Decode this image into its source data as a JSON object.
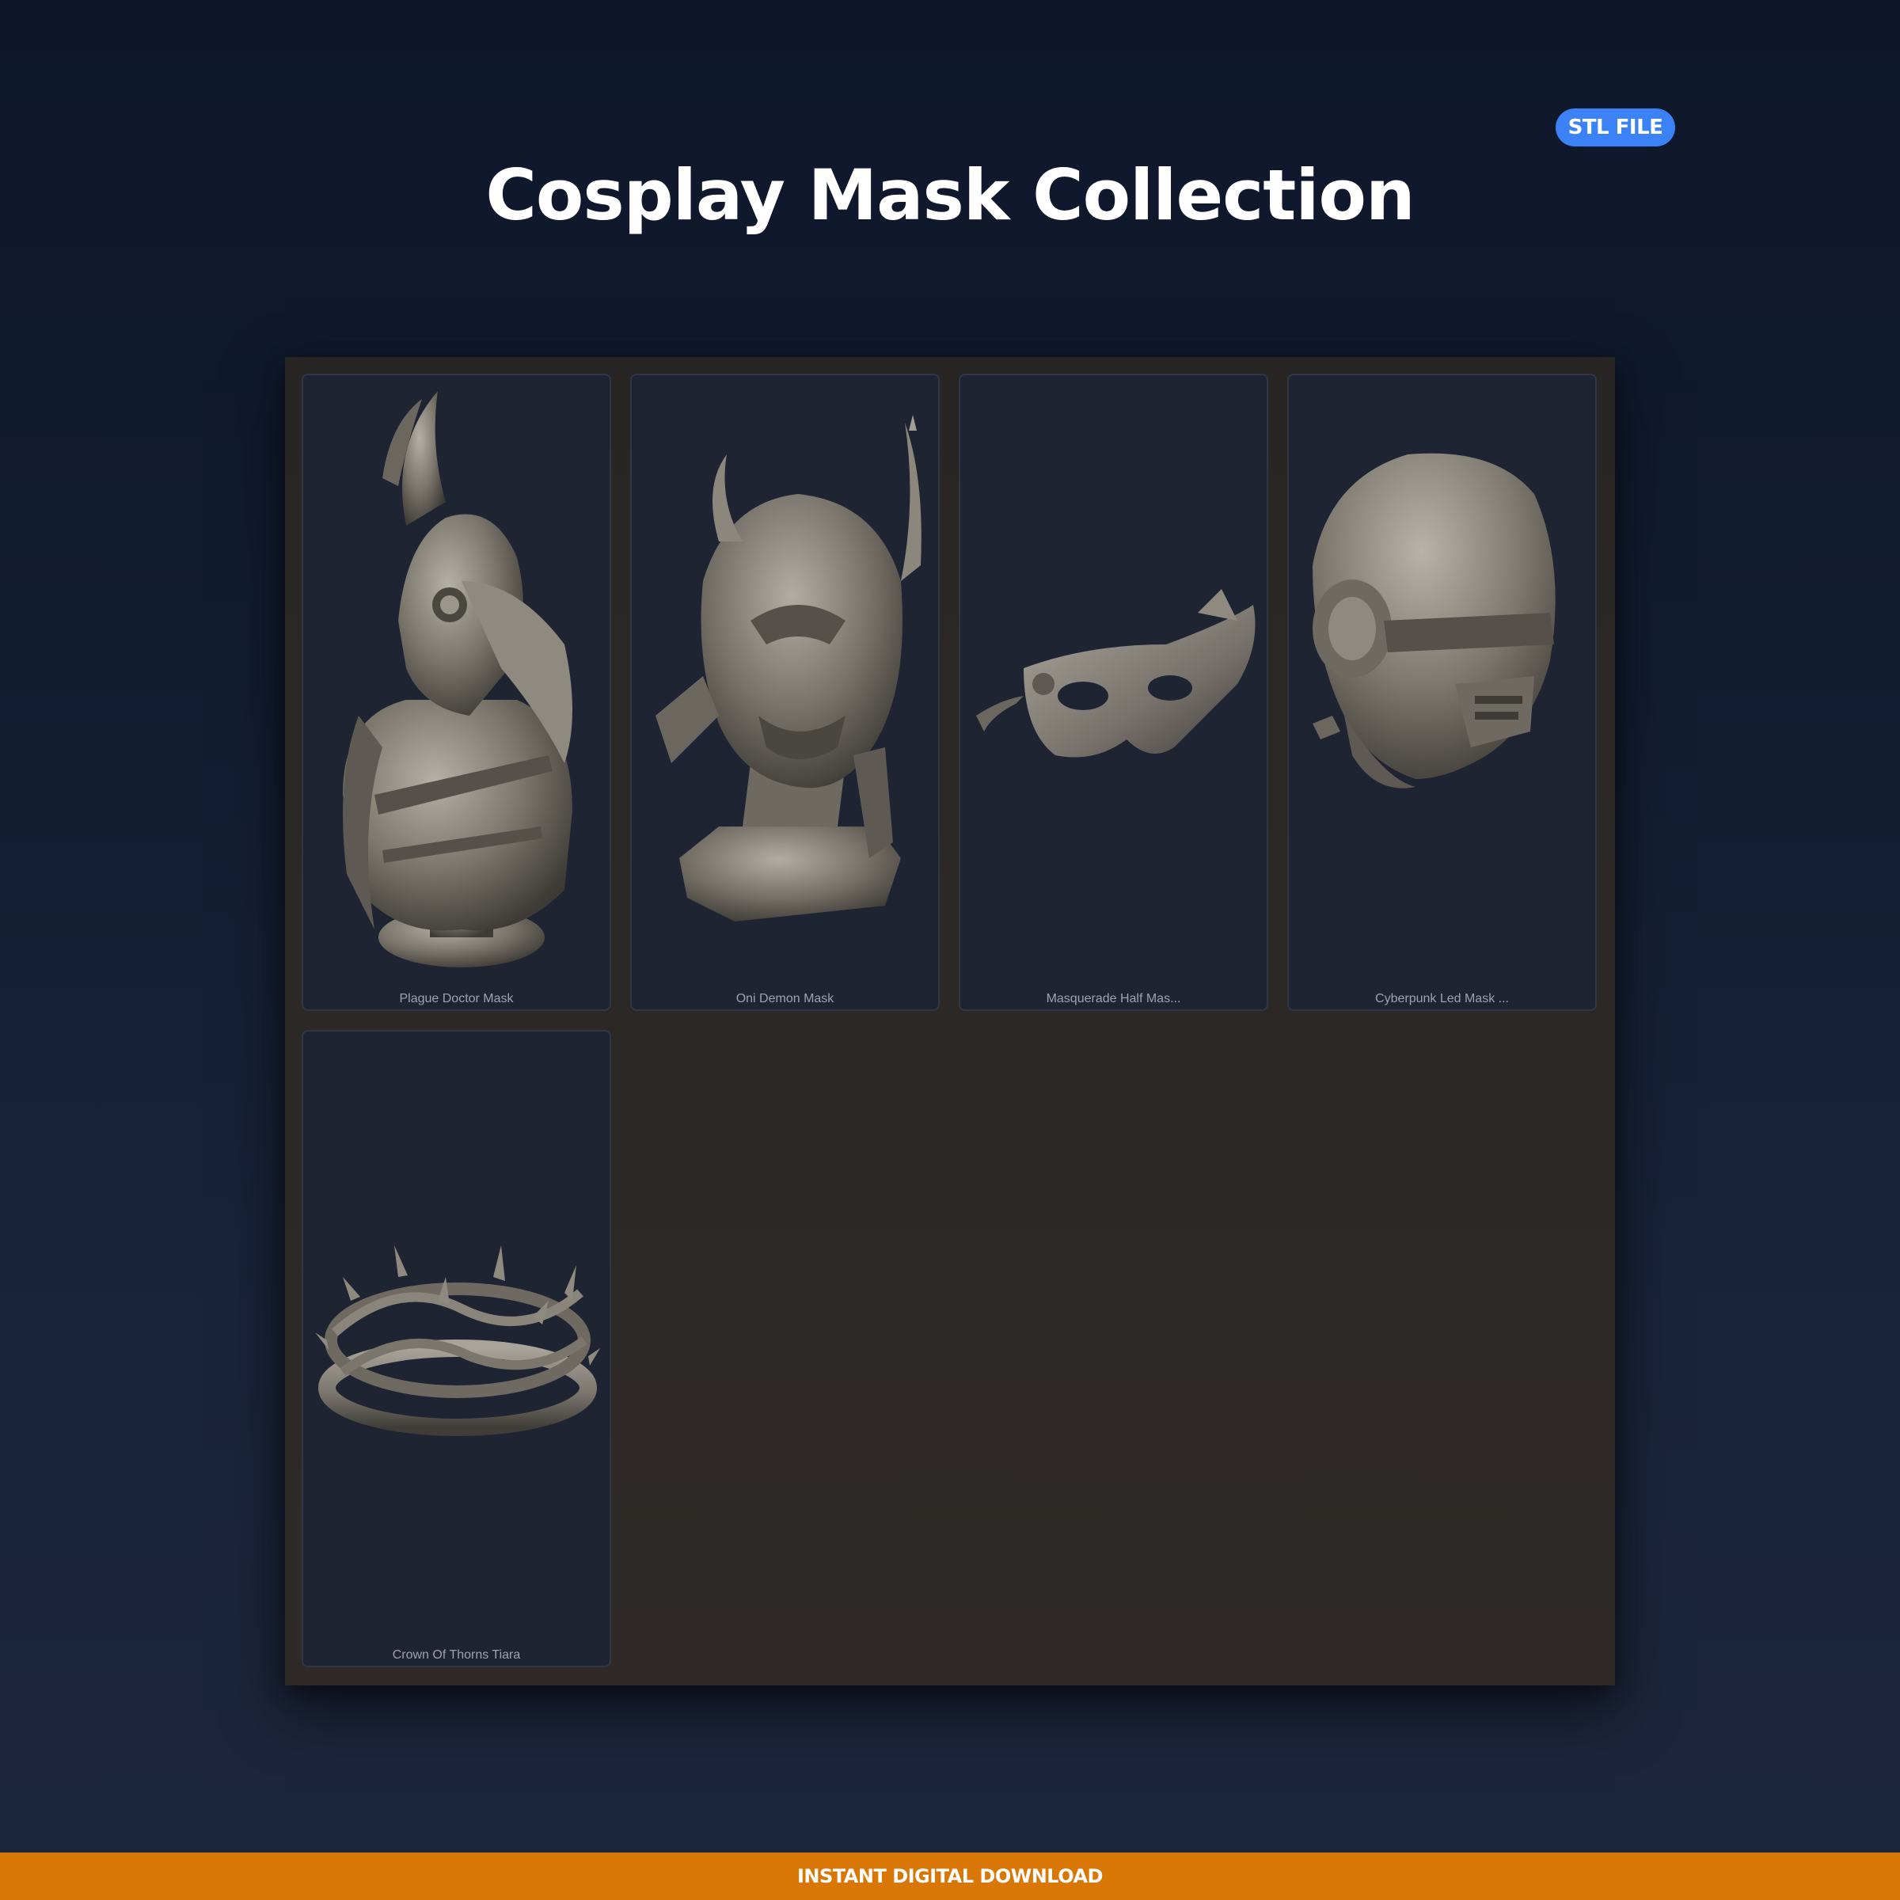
{
  "header": {
    "badge": "STL FILE",
    "title": "Cosplay Mask Collection"
  },
  "products": [
    {
      "label": "Plague Doctor Mask",
      "icon": "plague-doctor-mask-render"
    },
    {
      "label": "Oni Demon Mask",
      "icon": "oni-demon-mask-render"
    },
    {
      "label": "Masquerade Half Mas...",
      "icon": "masquerade-half-mask-render"
    },
    {
      "label": "Cyberpunk Led Mask ...",
      "icon": "cyberpunk-led-mask-render"
    },
    {
      "label": "Crown Of Thorns Tiara",
      "icon": "crown-of-thorns-tiara-render"
    }
  ],
  "footer": {
    "banner": "INSTANT DIGITAL DOWNLOAD"
  },
  "colors": {
    "badge": "#3b82f6",
    "footer": "#d97706",
    "model": "#7b766c"
  }
}
